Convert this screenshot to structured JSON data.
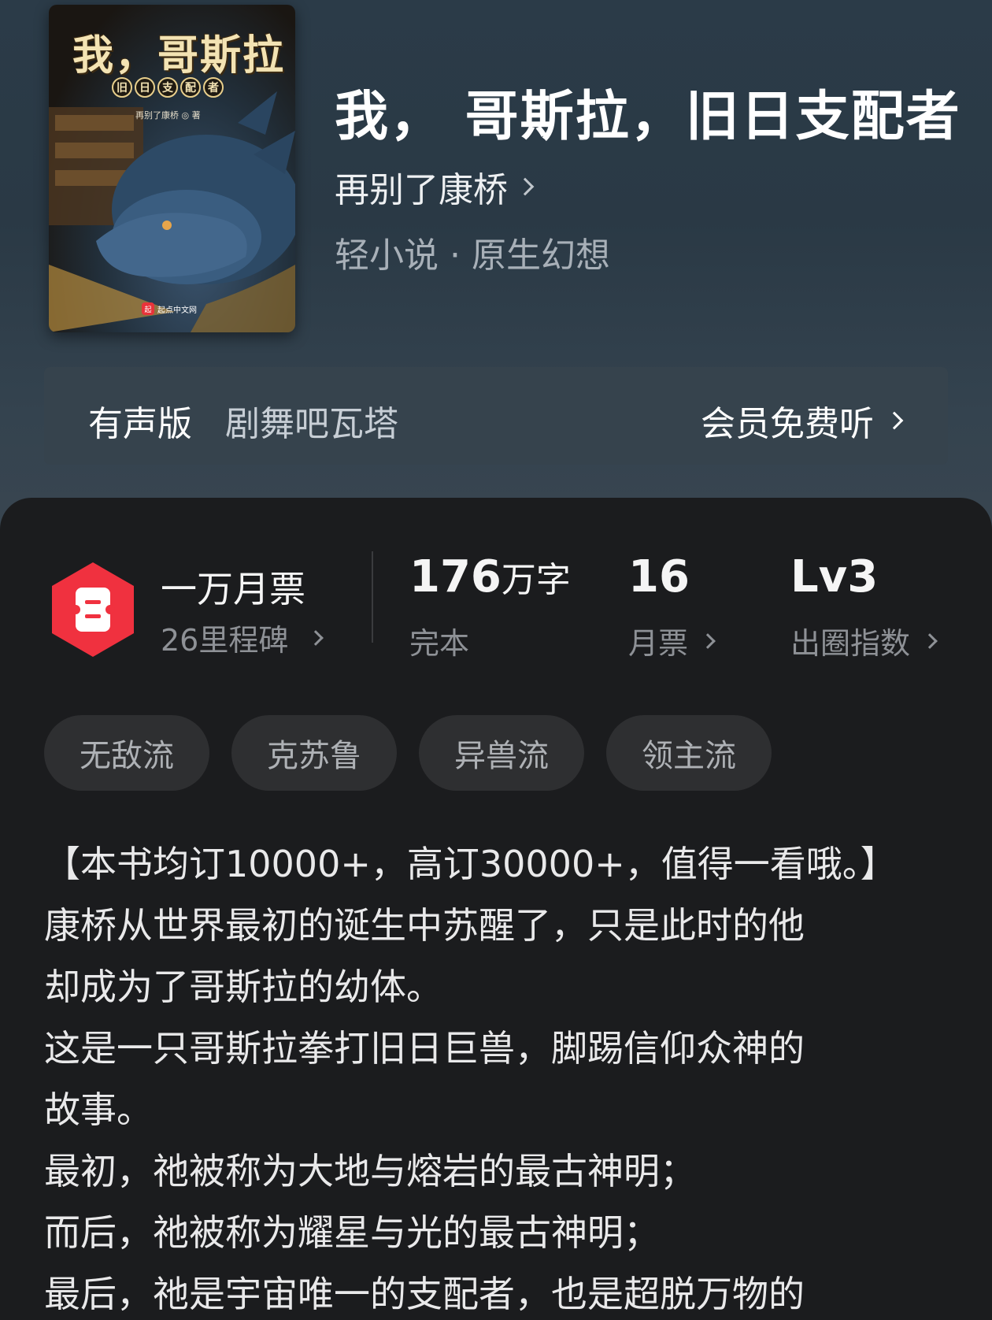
{
  "book": {
    "cover": {
      "title": "我，哥斯拉",
      "subtitle_chars": [
        "旧",
        "日",
        "支",
        "配",
        "者"
      ],
      "author_line": "再别了康桥 ◎ 著",
      "publisher": "起点中文网",
      "publisher_logo": "起"
    },
    "title": "我， 哥斯拉，旧日支配者",
    "author": "再别了康桥",
    "genre": "轻小说 · 原生幻想"
  },
  "audio": {
    "label": "有声版",
    "name": "剧舞吧瓦塔",
    "action": "会员免费听"
  },
  "stats": {
    "ticket": {
      "title": "一万月票",
      "sub": "26里程碑",
      "icon": "ticket-icon",
      "color": "#f0313f"
    },
    "words": {
      "value": "176",
      "unit": "万字",
      "sub": "完本"
    },
    "monthly": {
      "value": "16",
      "sub": "月票"
    },
    "influence": {
      "value": "Lv3",
      "sub": "出圈指数"
    }
  },
  "tags": [
    "无敌流",
    "克苏鲁",
    "异兽流",
    "领主流"
  ],
  "synopsis": [
    "【本书均订10000+，高订30000+，值得一看哦。】",
    "康桥从世界最初的诞生中苏醒了，只是此时的他",
    "却成为了哥斯拉的幼体。",
    "这是一只哥斯拉拳打旧日巨兽，脚踢信仰众神的",
    "故事。",
    "最初，祂被称为大地与熔岩的最古神明；",
    "而后，祂被称为耀星与光的最古神明；",
    "最后，祂是宇宙唯一的支配者，也是超脱万物的"
  ]
}
